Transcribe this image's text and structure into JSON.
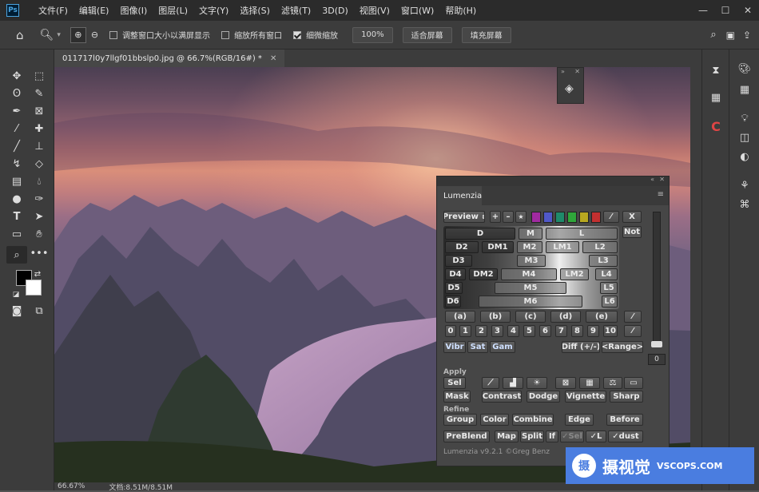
{
  "app": {
    "logo": "Ps"
  },
  "menu": [
    "文件(F)",
    "编辑(E)",
    "图像(I)",
    "图层(L)",
    "文字(Y)",
    "选择(S)",
    "滤镜(T)",
    "3D(D)",
    "视图(V)",
    "窗口(W)",
    "帮助(H)"
  ],
  "options": {
    "resize_windows": "调整窗口大小以满屏显示",
    "zoom_all": "缩放所有窗口",
    "scrubby_zoom": "细微缩放",
    "zoom_value": "100%",
    "fit_screen": "适合屏幕",
    "fill_screen": "填充屏幕"
  },
  "document": {
    "tab_title": "011717l0y7llgf01bbslp0.jpg @ 66.7%(RGB/16#) *",
    "zoom": "66.67%",
    "doc_info": "文档:8.51M/8.51M"
  },
  "lumenzia": {
    "tab": "Lumenzia",
    "preview": "Preview",
    "plus": "+",
    "minus": "–",
    "star": "★",
    "x": "X",
    "not": "Not",
    "swatch_colors": [
      "#a02aa0",
      "#5058c8",
      "#1f8a6a",
      "#2fa63a",
      "#b8a820",
      "#c23030"
    ],
    "row_d": [
      "D",
      "M",
      "L"
    ],
    "row2": [
      "D2",
      "DM1",
      "M2",
      "LM1",
      "L2"
    ],
    "row3": [
      "D3",
      "M3",
      "L3"
    ],
    "row4": [
      "D4",
      "DM2",
      "M4",
      "LM2",
      "L4"
    ],
    "row5": [
      "D5",
      "M5",
      "L5"
    ],
    "row6": [
      "D6",
      "M6",
      "L6"
    ],
    "letters": [
      "(a)",
      "(b)",
      "(c)",
      "(d)",
      "(e)"
    ],
    "numbers": [
      "0",
      "1",
      "2",
      "3",
      "4",
      "5",
      "6",
      "7",
      "8",
      "9",
      "10"
    ],
    "vibr": "Vibr",
    "sat": "Sat",
    "gam": "Gam",
    "diff": "Diff (+/-)",
    "range": "<Range>",
    "slider_value": "0",
    "apply_label": "Apply",
    "sel": "Sel",
    "apply_row": [
      "Mask",
      "Contrast",
      "Dodge",
      "Vignette",
      "Sharp"
    ],
    "refine_label": "Refine",
    "refine_row": [
      "Group",
      "Color",
      "Combine",
      "Edge",
      "Before"
    ],
    "bottom_row": [
      "PreBlend",
      "Map",
      "Split",
      "If",
      "✓Sel",
      "✓L",
      "✓dust"
    ],
    "version": "Lumenzia v9.2.1 ©Greg Benz"
  },
  "watermark": {
    "logo": "摄",
    "name": "摄视觉",
    "site": "VSCOPS.COM"
  }
}
